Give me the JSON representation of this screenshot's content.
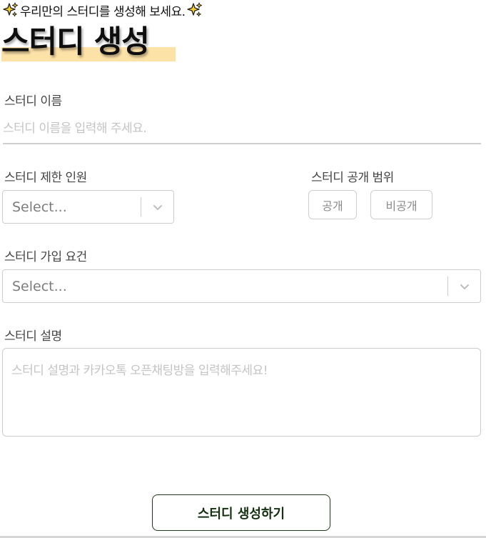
{
  "header": {
    "subtitle": "우리만의 스터디를 생성해 보세요.",
    "sparkle_icon": "sparkles-icon",
    "title": "스터디 생성",
    "highlight_color": "#fde2a8"
  },
  "form": {
    "name": {
      "label": "스터디 이름",
      "placeholder": "스터디 이름을 입력해 주세요."
    },
    "capacity": {
      "label": "스터디 제한 인원",
      "value": "Select..."
    },
    "visibility": {
      "label": "스터디 공개 범위",
      "options": [
        "공개",
        "비공개"
      ]
    },
    "requirement": {
      "label": "스터디 가입 요건",
      "value": "Select..."
    },
    "description": {
      "label": "스터디 설명",
      "placeholder": "스터디 설명과 카카오톡 오픈채팅방을 입력해주세요!"
    },
    "submit_label": "스터디 생성하기"
  },
  "colors": {
    "accent": "#13300f",
    "border": "#cccccc",
    "placeholder": "#c4c4c4"
  }
}
